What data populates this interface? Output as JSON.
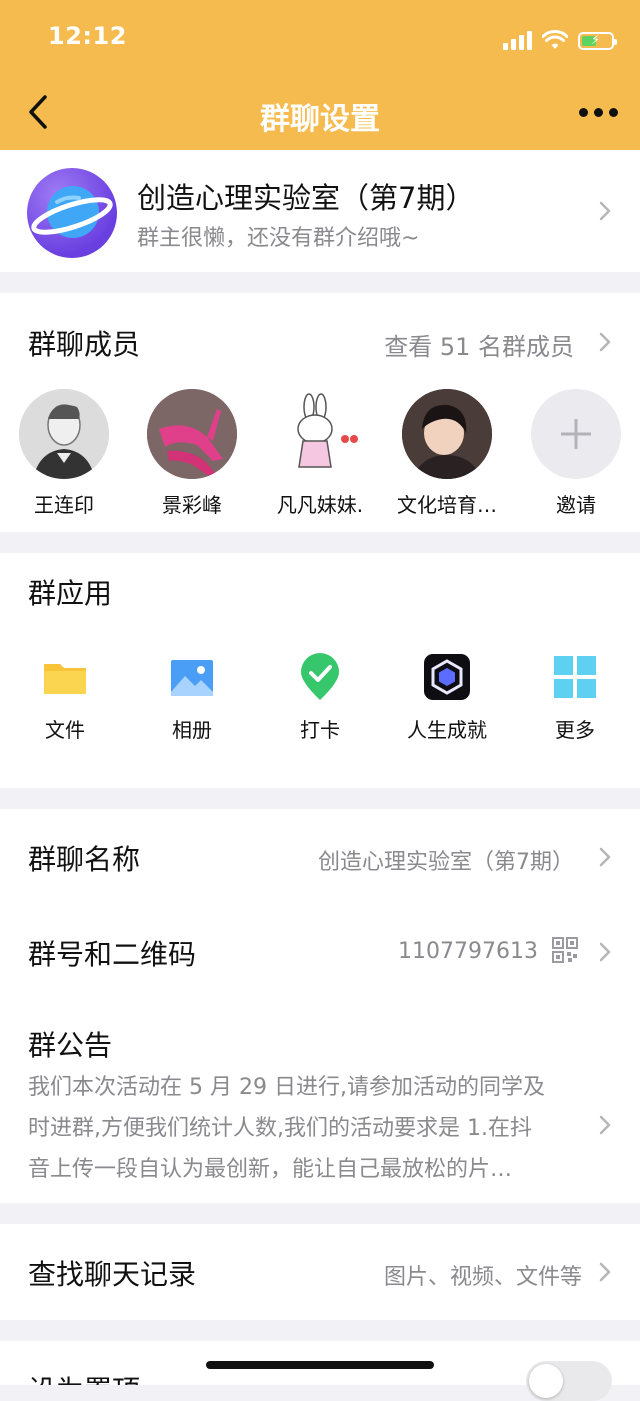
{
  "status_bar": {
    "time": "12:12"
  },
  "nav": {
    "title": "群聊设置"
  },
  "group": {
    "name": "创造心理实验室（第7期）",
    "intro": "群主很懒，还没有群介绍哦~"
  },
  "members": {
    "title": "群聊成员",
    "view_all": "查看 51 名群成员",
    "list": [
      {
        "name": "王连印"
      },
      {
        "name": "景彩峰"
      },
      {
        "name": "凡凡妹妹."
      },
      {
        "name": "文化培育…"
      }
    ],
    "invite_label": "邀请"
  },
  "apps": {
    "title": "群应用",
    "items": [
      {
        "label": "文件",
        "icon": "folder-icon"
      },
      {
        "label": "相册",
        "icon": "album-icon"
      },
      {
        "label": "打卡",
        "icon": "check-in-icon"
      },
      {
        "label": "人生成就",
        "icon": "achievement-icon"
      },
      {
        "label": "更多",
        "icon": "more-apps-icon"
      }
    ]
  },
  "settings": {
    "group_name_label": "群聊名称",
    "group_name_value": "创造心理实验室（第7期）",
    "group_id_label": "群号和二维码",
    "group_id_value": "1107797613",
    "notice_label": "群公告",
    "notice_lines": [
      "我们本次活动在 5 月 29 日进行,请参加活动的同学及",
      "时进群,方便我们统计人数,我们的活动要求是 1.在抖",
      "音上传一段自认为最创新，能让自己最放松的片…"
    ],
    "search_label": "查找聊天记录",
    "search_value": "图片、视频、文件等",
    "pin_label": "设为置顶"
  },
  "colors": {
    "header_bg": "#f5bb4f",
    "page_bg": "#f2f2f6",
    "secondary_text": "#8a8a8e"
  }
}
